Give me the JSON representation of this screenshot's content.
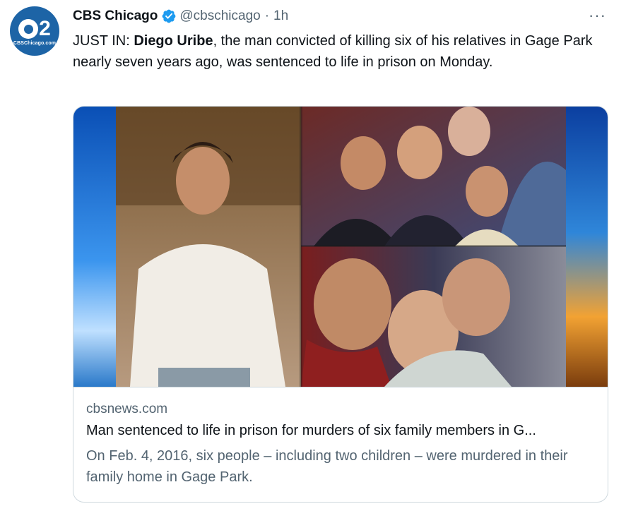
{
  "author": {
    "avatar_number": "2",
    "avatar_site": "CBSChicago.com",
    "name": "CBS Chicago",
    "handle": "@cbschicago",
    "separator": "·",
    "time": "1h"
  },
  "more_label": "···",
  "tweet": {
    "prefix": "JUST IN: ",
    "bold": "Diego Uribe",
    "rest": ", the man convicted of killing six of his relatives in Gage Park nearly seven years ago, was sentenced to life in prison on Monday."
  },
  "card": {
    "domain": "cbsnews.com",
    "title": "Man sentenced to life in prison for murders of six family members in G...",
    "description": "On Feb. 4, 2016, six people – including two children – were murdered in their family home in Gage Park."
  },
  "colors": {
    "brand": "#1d64a6",
    "verified": "#1d9bf0",
    "muted": "#536471",
    "text": "#0f1419",
    "border": "#cfd9de"
  }
}
